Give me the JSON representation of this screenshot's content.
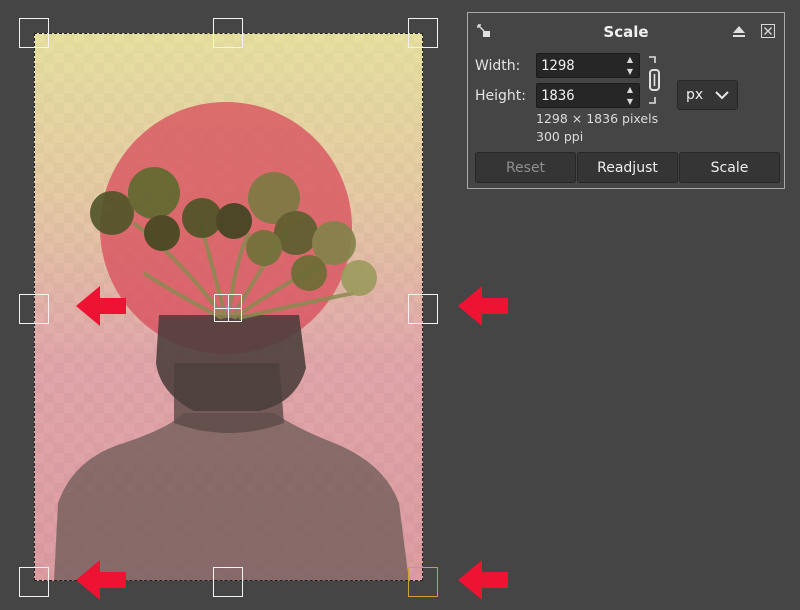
{
  "dialog": {
    "title": "Scale",
    "width_label": "Width:",
    "width_value": "1298",
    "height_label": "Height:",
    "height_value": "1836",
    "unit": "px",
    "size_info": "1298 × 1836 pixels",
    "resolution_info": "300 ppi",
    "buttons": {
      "reset": "Reset",
      "readjust": "Readjust",
      "scale": "Scale"
    }
  },
  "colors": {
    "canvas_bg": "#454545",
    "handle": "#f2f2f2",
    "active_handle": "#c9a23a",
    "annotation_arrow": "#ee1233",
    "circle": "#d9505e"
  }
}
